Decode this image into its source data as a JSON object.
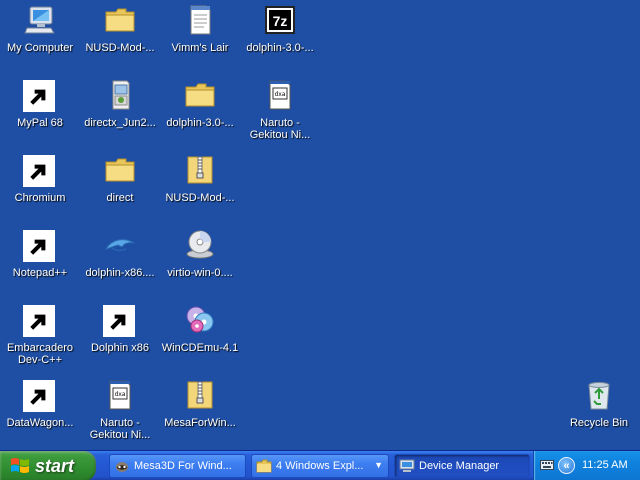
{
  "desktop": {
    "icons": [
      {
        "label": "My Computer",
        "icon": "my-computer-icon"
      },
      {
        "label": "NUSD-Mod-...",
        "icon": "folder-icon"
      },
      {
        "label": "Vimm's Lair",
        "icon": "text-document-icon"
      },
      {
        "label": "dolphin-3.0-...",
        "icon": "7z-archive-icon"
      },
      {
        "label": "MyPal 68",
        "icon": "mypal-raccoon-icon"
      },
      {
        "label": "directx_Jun2...",
        "icon": "installer-package-icon"
      },
      {
        "label": "dolphin-3.0-...",
        "icon": "folder-icon"
      },
      {
        "label": "Naruto -\nGekitou Ni...",
        "icon": "iso-file-icon"
      },
      {
        "label": "Chromium",
        "icon": "chromium-icon"
      },
      {
        "label": "direct",
        "icon": "folder-icon"
      },
      {
        "label": "NUSD-Mod-...",
        "icon": "zip-folder-icon"
      },
      {
        "label": "Notepad++",
        "icon": "notepad-plus-plus-icon"
      },
      {
        "label": "dolphin-x86....",
        "icon": "dolphin-icon"
      },
      {
        "label": "virtio-win-0....",
        "icon": "cd-image-icon"
      },
      {
        "label": "Embarcadero\nDev-C++",
        "icon": "devcpp-icon"
      },
      {
        "label": "Dolphin x86",
        "icon": "dolphin-icon"
      },
      {
        "label": "WinCDEmu-4.1",
        "icon": "wincdemu-icon"
      },
      {
        "label": "DataWagon...",
        "icon": "iso-file-icon"
      },
      {
        "label": "Naruto -\nGekitou Ni...",
        "icon": "iso-file-icon"
      },
      {
        "label": "MesaForWin...",
        "icon": "zip-folder-icon"
      },
      {
        "label": "Recycle Bin",
        "icon": "recycle-bin-icon"
      }
    ]
  },
  "taskbar": {
    "start_label": "start",
    "tasks": [
      {
        "label": "Mesa3D For Wind...",
        "icon": "mypal-raccoon-icon"
      },
      {
        "label": "4 Windows Expl...",
        "icon": "folder-icon"
      },
      {
        "label": "Device Manager",
        "icon": "device-manager-icon"
      }
    ],
    "clock": "11:25 AM",
    "tray_expand_glyph": "«"
  },
  "colors": {
    "desktop_bg": "#1f4fa4",
    "taskbar_blue": "#2457d4",
    "start_green": "#3c9a3c",
    "tray_blue": "#0f82de"
  }
}
